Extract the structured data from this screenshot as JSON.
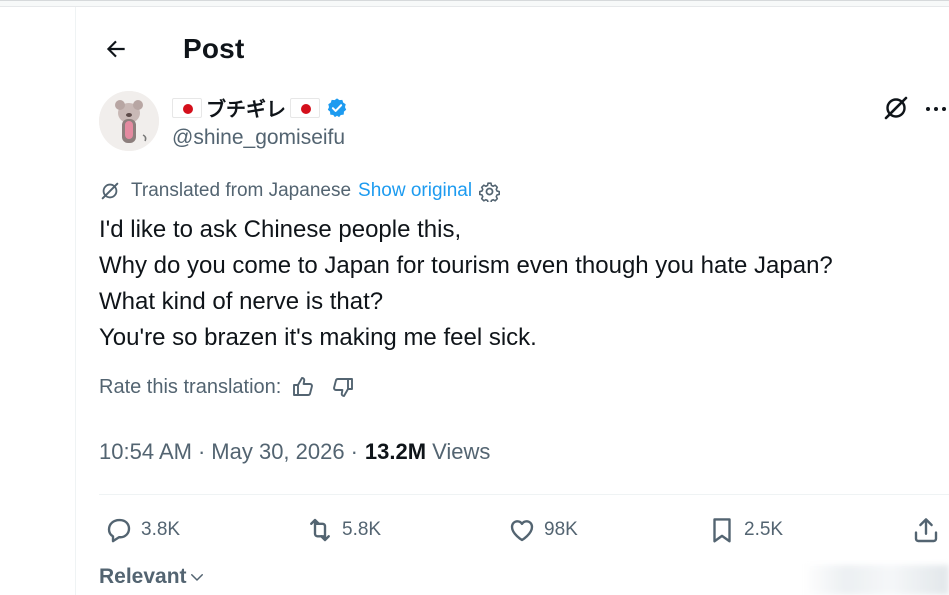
{
  "header": {
    "title": "Post"
  },
  "author": {
    "name": "ブチギレ",
    "handle": "@shine_gomiseifu",
    "verified": true,
    "flag": "japan-flag"
  },
  "translation": {
    "label": "Translated from Japanese",
    "show_original": "Show original"
  },
  "post": {
    "lines": [
      "I'd like to ask Chinese people this,",
      "Why do you come to Japan for tourism even though you hate Japan?",
      "What kind of nerve is that?",
      "You're so brazen it's making me feel sick."
    ]
  },
  "rate": {
    "label": "Rate this translation:"
  },
  "meta": {
    "time": "10:54 AM",
    "dot": "·",
    "date": "May 30, 2026",
    "views_count": "13.2M",
    "views_label": "Views"
  },
  "actions": {
    "replies": "3.8K",
    "reposts": "5.8K",
    "likes": "98K",
    "bookmarks": "2.5K"
  },
  "sort": {
    "label": "Relevant"
  },
  "colors": {
    "accent": "#1d9bf0",
    "secondary_text": "#536471",
    "primary_text": "#0f1419",
    "flag_red": "#d40f1b"
  }
}
